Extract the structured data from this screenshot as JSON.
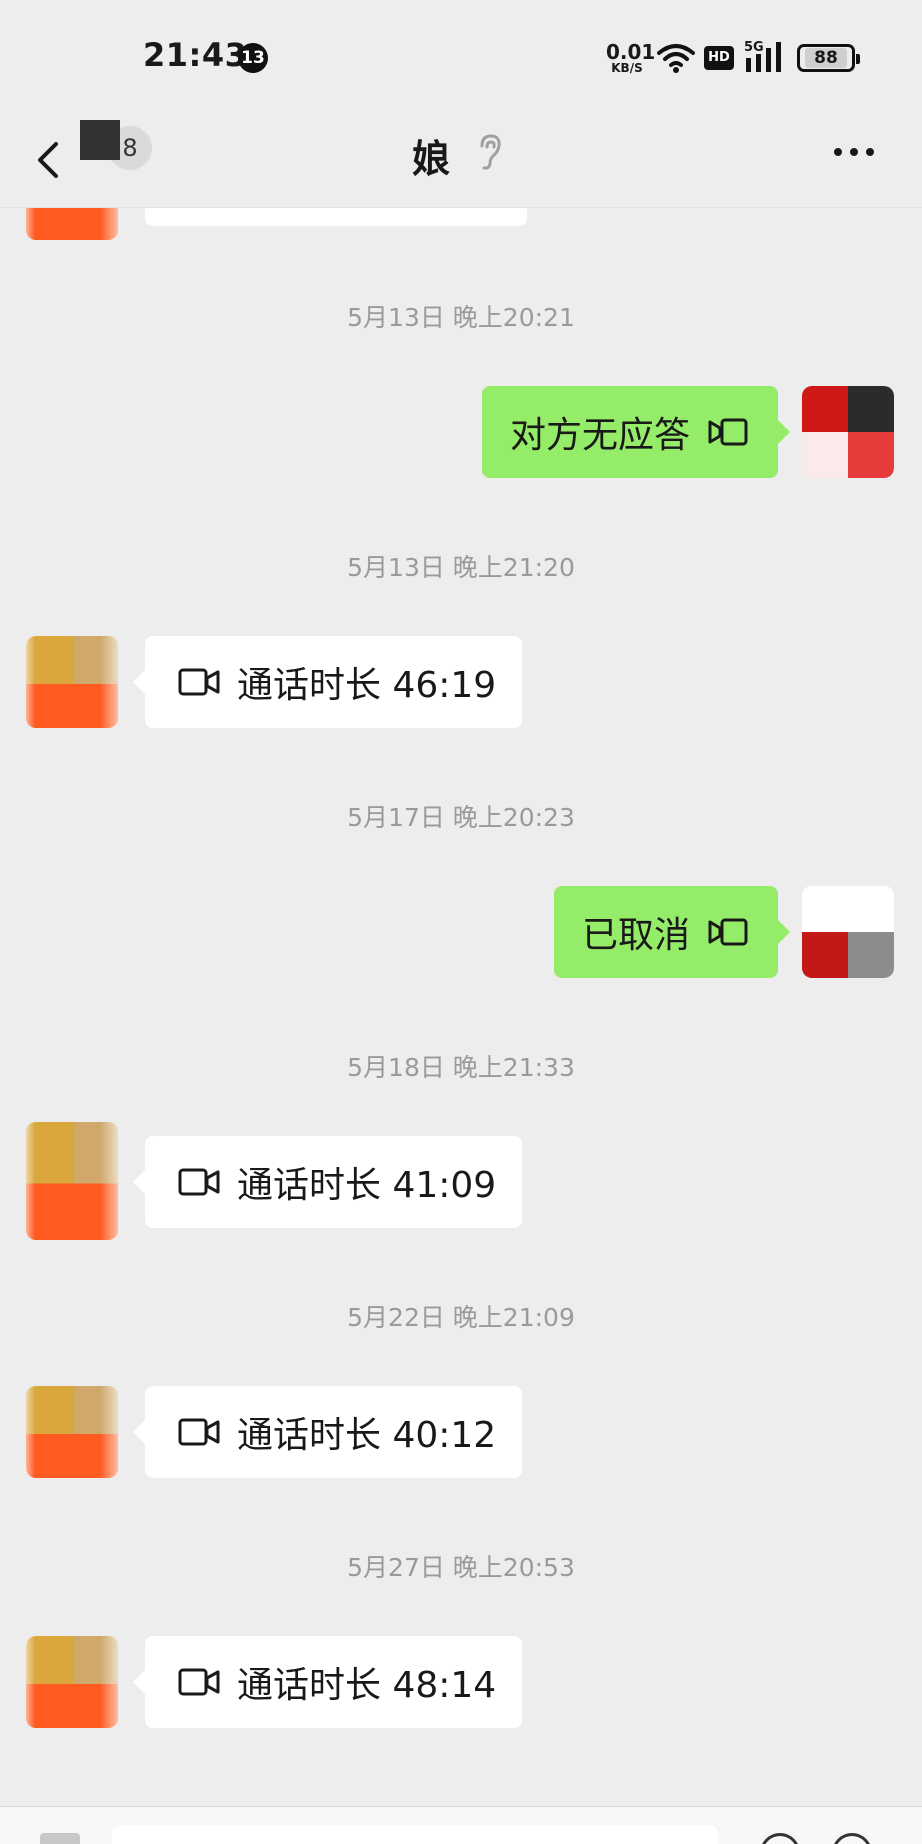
{
  "status_bar": {
    "time": "21:43",
    "notification_count": "13",
    "net_speed_value": "0.01",
    "net_speed_unit": "KB/S",
    "hd_label": "HD",
    "network_label": "5G",
    "battery": "88"
  },
  "header": {
    "unread_count": "8",
    "title": "娘"
  },
  "messages": [
    {
      "timestamp": "5月13日 晚上20:21",
      "side": "right",
      "text": "对方无应答"
    },
    {
      "timestamp": "5月13日 晚上21:20",
      "side": "left",
      "text": "通话时长 46:19"
    },
    {
      "timestamp": "5月17日 晚上20:23",
      "side": "right",
      "text": "已取消"
    },
    {
      "timestamp": "5月18日 晚上21:33",
      "side": "left",
      "text": "通话时长 41:09"
    },
    {
      "timestamp": "5月22日 晚上21:09",
      "side": "left",
      "text": "通话时长 40:12"
    },
    {
      "timestamp": "5月27日 晚上20:53",
      "side": "left",
      "text": "通话时长 48:14"
    }
  ],
  "icons": {
    "back": "chevron-left-icon",
    "ear": "ear-icon",
    "more": "more-dots-icon",
    "video": "video-call-icon",
    "wifi": "wifi-icon",
    "signal": "signal-icon"
  },
  "colors": {
    "background": "#ededed",
    "sent_bubble": "#95ec69",
    "received_bubble": "#ffffff",
    "timestamp_text": "#9a9a9a"
  }
}
